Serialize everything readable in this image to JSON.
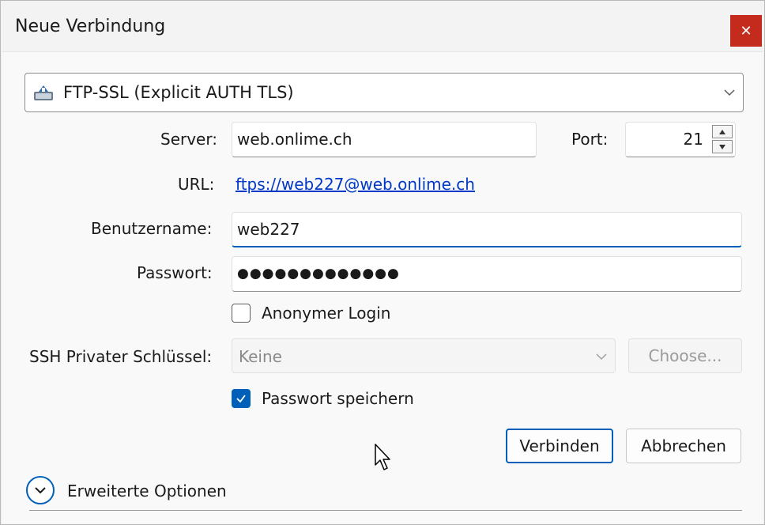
{
  "window": {
    "title": "Neue Verbindung",
    "close_glyph": "✕"
  },
  "protocol": {
    "selected": "FTP-SSL (Explicit AUTH TLS)",
    "icon": "drive-icon"
  },
  "server": {
    "label": "Server:",
    "value": "web.onlime.ch"
  },
  "port": {
    "label": "Port:",
    "value": "21"
  },
  "url": {
    "label": "URL:",
    "value": "ftps://web227@web.onlime.ch"
  },
  "username": {
    "label": "Benutzername:",
    "value": "web227"
  },
  "password": {
    "label": "Passwort:",
    "value": "●●●●●●●●●●●●●"
  },
  "anonymous": {
    "label": "Anonymer Login",
    "checked": false
  },
  "ssh_key": {
    "label": "SSH Privater Schlüssel:",
    "value": "Keine",
    "choose_label": "Choose..."
  },
  "save_password": {
    "label": "Passwort speichern",
    "checked": true
  },
  "buttons": {
    "connect": "Verbinden",
    "cancel": "Abbrechen"
  },
  "advanced": {
    "label": "Erweiterte Optionen"
  },
  "colors": {
    "accent": "#005fb8",
    "close": "#c42b1c",
    "link": "#0038c8"
  }
}
